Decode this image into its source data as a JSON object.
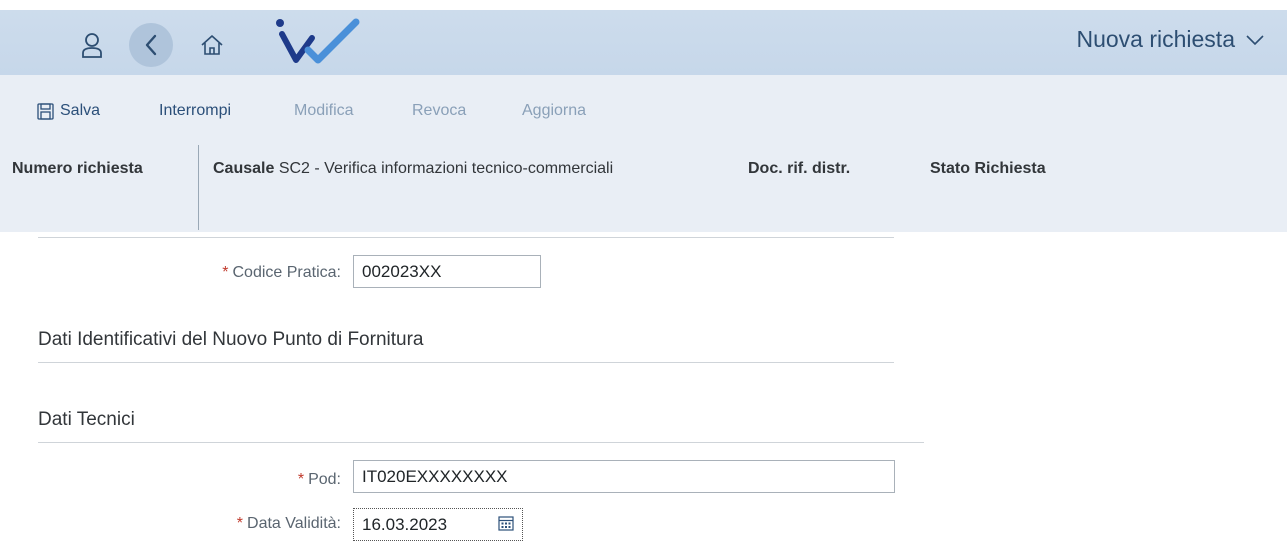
{
  "shell": {
    "title": "Nuova richiesta",
    "icons": {
      "user": "user-icon",
      "back": "back-icon",
      "home": "home-icon",
      "logo": "app-logo",
      "dropdown": "chevron-down-icon"
    },
    "colors": {
      "bar": "#c6d7ea",
      "back_bg": "#afc4db",
      "title": "#2d4e72",
      "logo_dark": "#1e3a8a",
      "logo_light": "#4a90d9"
    }
  },
  "toolbar": {
    "save_label": "Salva",
    "interrupt_label": "Interrompi",
    "modify_label": "Modifica",
    "revoke_label": "Revoca",
    "update_label": "Aggiorna",
    "save_icon": "save-icon"
  },
  "header": {
    "request_number_label": "Numero richiesta",
    "causale_label": "Causale",
    "causale_value": "SC2 - Verifica informazioni tecnico-commerciali",
    "doc_ref_label": "Doc. rif. distr.",
    "status_label": "Stato Richiesta"
  },
  "form": {
    "codice_pratica": {
      "required": "*",
      "label": "Codice Pratica:",
      "value": "002023XX"
    },
    "section_punto_fornitura": "Dati Identificativi del Nuovo Punto di Fornitura",
    "section_dati_tecnici": "Dati Tecnici",
    "pod": {
      "required": "*",
      "label": "Pod:",
      "value": "IT020EXXXXXXXX"
    },
    "data_validita": {
      "required": "*",
      "label": "Data Validità:",
      "value": "16.03.2023",
      "icon": "calendar-icon"
    }
  }
}
